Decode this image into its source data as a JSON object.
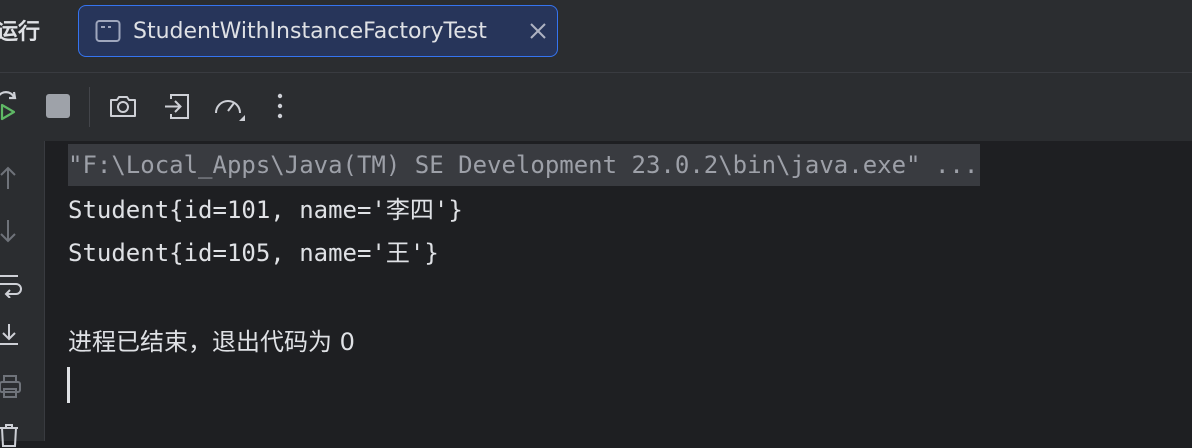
{
  "window": {
    "run_label": "运行"
  },
  "tabs": [
    {
      "title": "StudentWithInstanceFactoryTest",
      "active": true
    }
  ],
  "toolbar": {
    "icons": [
      "rerun-icon",
      "stop-icon",
      "camera-icon",
      "exit-icon",
      "gauge-icon",
      "more-icon"
    ]
  },
  "sidebar": {
    "icons": [
      "arrow-up-icon",
      "arrow-down-icon",
      "soft-wrap-icon",
      "scroll-to-end-icon",
      "print-icon",
      "trash-icon"
    ]
  },
  "console": {
    "command": "\"F:\\Local_Apps\\Java(TM) SE Development 23.0.2\\bin\\java.exe\" ...",
    "output": [
      "Student{id=101, name='李四'}",
      "Student{id=105, name='王'}"
    ],
    "exit_message": "进程已结束，退出代码为 0"
  },
  "colors": {
    "accent": "#3574f0",
    "background": "#1e1f22",
    "panel": "#2b2d30",
    "run_green": "#5fb865"
  }
}
